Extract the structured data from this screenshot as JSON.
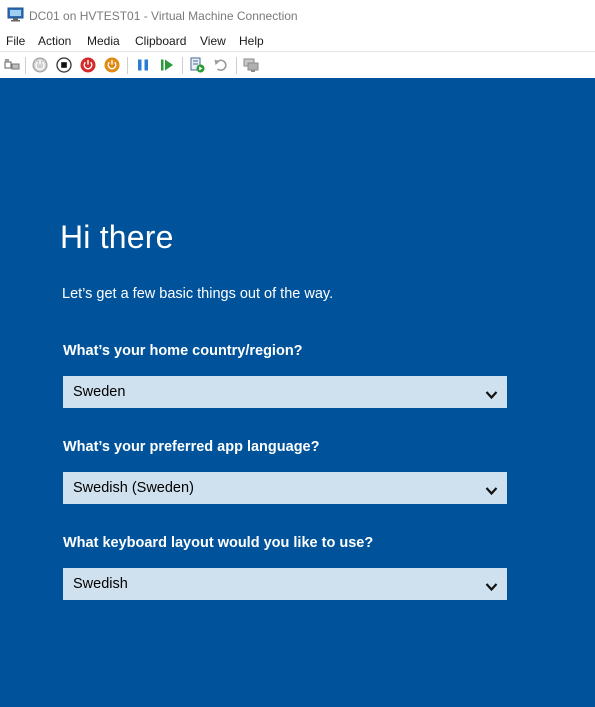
{
  "window": {
    "title": "DC01 on HVTEST01 - Virtual Machine Connection",
    "icon": "vm-connection-icon"
  },
  "menu": {
    "items": [
      "File",
      "Action",
      "Media",
      "Clipboard",
      "View",
      "Help"
    ]
  },
  "toolbar": {
    "buttons": [
      "ctrl-alt-del-icon",
      "start-icon",
      "turn-off-icon",
      "shut-down-icon",
      "save-state-icon",
      "pause-icon",
      "resume-icon",
      "checkpoint-icon",
      "revert-icon",
      "enhanced-session-icon"
    ]
  },
  "setup": {
    "heading": "Hi there",
    "subtitle": "Let’s get a few basic things out of the way.",
    "questions": [
      {
        "label": "What’s your home country/region?",
        "value": "Sweden"
      },
      {
        "label": "What’s your preferred app language?",
        "value": "Swedish (Sweden)"
      },
      {
        "label": "What keyboard layout would you like to use?",
        "value": "Swedish"
      }
    ]
  },
  "colors": {
    "background": "#00539b",
    "dropdown": "#cfe0ee",
    "text": "#ffffff",
    "toolbar_red": "#d42a2a",
    "toolbar_orange": "#e08a12",
    "toolbar_blue": "#2a7bd3",
    "toolbar_green": "#2a9a3a"
  }
}
